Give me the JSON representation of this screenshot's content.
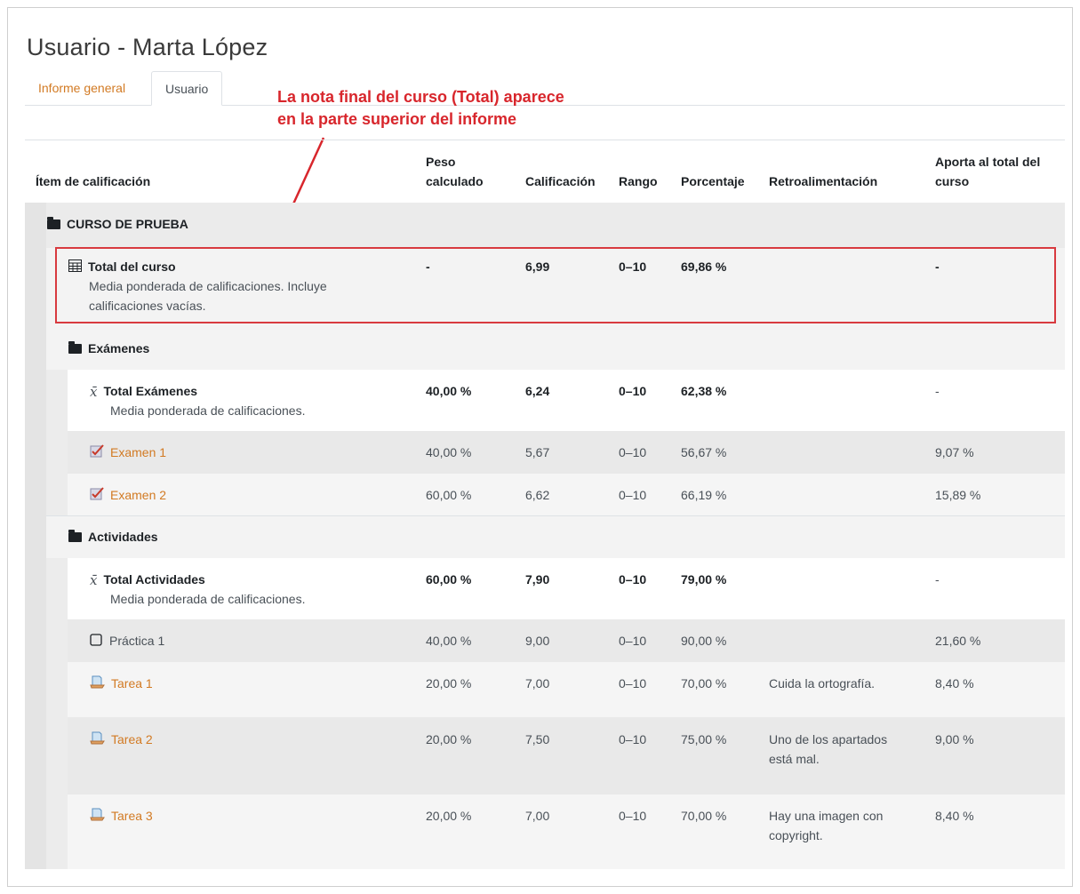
{
  "page": {
    "title": "Usuario - Marta López"
  },
  "tabs": [
    {
      "label": "Informe general"
    },
    {
      "label": "Usuario"
    }
  ],
  "annotation": {
    "line1": "La nota final del curso (Total) aparece",
    "line2": "en la parte superior del informe",
    "color": "#d8262c"
  },
  "columns": {
    "item": "Ítem de calificación",
    "peso_1": "Peso",
    "peso_2": "calculado",
    "calificacion": "Calificación",
    "rango": "Rango",
    "porcentaje": "Porcentaje",
    "retro": "Retroalimentación",
    "aporta_1": "Aporta al total del",
    "aporta_2": "curso"
  },
  "rows": {
    "curso": {
      "label": "CURSO DE PRUEBA",
      "icon": "folder-icon"
    },
    "total_curso": {
      "label": "Total del curso",
      "desc1": "Media ponderada de calificaciones. Incluye",
      "desc2": "calificaciones vacías.",
      "peso": "-",
      "calificacion": "6,99",
      "rango": "0–10",
      "porcentaje": "69,86 %",
      "retro": "",
      "aporta": "-",
      "icon": "calculator-icon"
    },
    "examenes": {
      "label": "Exámenes",
      "icon": "folder-icon"
    },
    "total_examenes": {
      "label": "Total Exámenes",
      "desc": "Media ponderada de calificaciones.",
      "peso": "40,00 %",
      "calificacion": "6,24",
      "rango": "0–10",
      "porcentaje": "62,38 %",
      "aporta": "-",
      "icon": "mean-icon"
    },
    "examen1": {
      "label": "Examen 1",
      "peso": "40,00 %",
      "calificacion": "5,67",
      "rango": "0–10",
      "porcentaje": "56,67 %",
      "retro": "",
      "aporta": "9,07 %",
      "icon": "quiz-icon"
    },
    "examen2": {
      "label": "Examen 2",
      "peso": "60,00 %",
      "calificacion": "6,62",
      "rango": "0–10",
      "porcentaje": "66,19 %",
      "retro": "",
      "aporta": "15,89 %",
      "icon": "quiz-icon"
    },
    "actividades": {
      "label": "Actividades",
      "icon": "folder-icon"
    },
    "total_actividades": {
      "label": "Total Actividades",
      "desc": "Media ponderada de calificaciones.",
      "peso": "60,00 %",
      "calificacion": "7,90",
      "rango": "0–10",
      "porcentaje": "79,00 %",
      "aporta": "-",
      "icon": "mean-icon"
    },
    "practica1": {
      "label": "Práctica 1",
      "peso": "40,00 %",
      "calificacion": "9,00",
      "rango": "0–10",
      "porcentaje": "90,00 %",
      "retro": "",
      "aporta": "21,60 %",
      "icon": "manual-item-icon"
    },
    "tarea1": {
      "label": "Tarea 1",
      "peso": "20,00 %",
      "calificacion": "7,00",
      "rango": "0–10",
      "porcentaje": "70,00 %",
      "retro1": "Cuida la ortografía.",
      "retro2": "",
      "aporta": "8,40 %",
      "icon": "assignment-icon"
    },
    "tarea2": {
      "label": "Tarea 2",
      "peso": "20,00 %",
      "calificacion": "7,50",
      "rango": "0–10",
      "porcentaje": "75,00 %",
      "retro1": "Uno de los apartados",
      "retro2": "está mal.",
      "aporta": "9,00 %",
      "icon": "assignment-icon"
    },
    "tarea3": {
      "label": "Tarea 3",
      "peso": "20,00 %",
      "calificacion": "7,00",
      "rango": "0–10",
      "porcentaje": "70,00 %",
      "retro1": "Hay una imagen con",
      "retro2": "copyright.",
      "aporta": "8,40 %",
      "icon": "assignment-icon"
    }
  },
  "colors": {
    "link": "#d27a23",
    "band": "#ebebeb",
    "rail": "#e4e4e4"
  }
}
